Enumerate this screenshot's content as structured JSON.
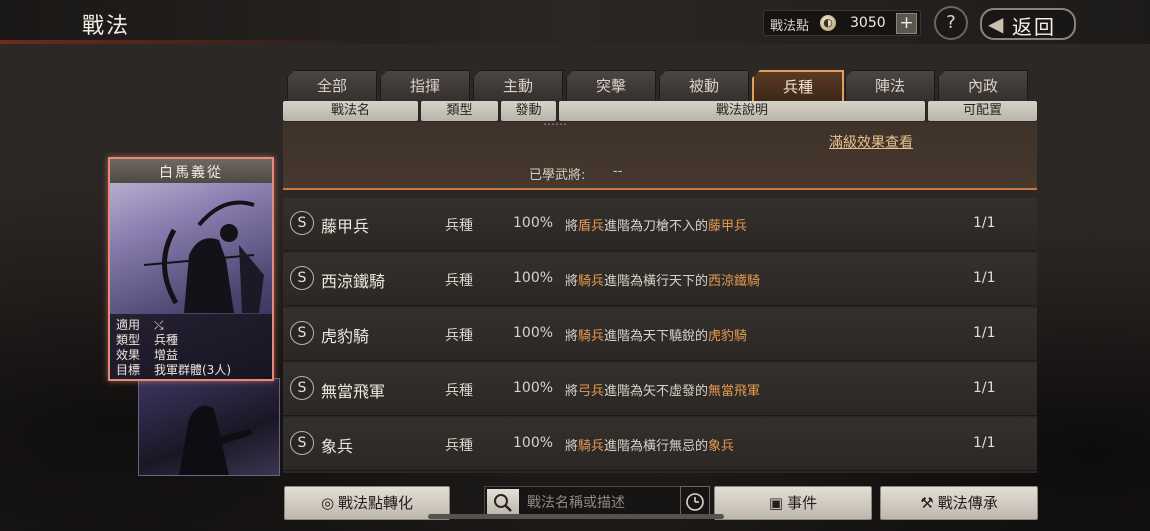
{
  "header": {
    "title": "戰法",
    "points_label": "戰法點",
    "points_value": "3050",
    "plus_label": "+",
    "help_label": "?",
    "back_label": "返回"
  },
  "tabs": [
    {
      "label": "全部",
      "active": false
    },
    {
      "label": "指揮",
      "active": false
    },
    {
      "label": "主動",
      "active": false
    },
    {
      "label": "突擊",
      "active": false
    },
    {
      "label": "被動",
      "active": false
    },
    {
      "label": "兵種",
      "active": true
    },
    {
      "label": "陣法",
      "active": false
    },
    {
      "label": "內政",
      "active": false
    }
  ],
  "columns": [
    "戰法名",
    "類型",
    "發動",
    "戰法說明",
    "可配置"
  ],
  "detail": {
    "full_effect_link": "滿級效果查看",
    "learned_label": "已學武將:",
    "learned_value": "--"
  },
  "skills": [
    {
      "grade": "S",
      "name": "藤甲兵",
      "type": "兵種",
      "rate": "100%",
      "desc_parts": [
        {
          "t": "將",
          "hl": false
        },
        {
          "t": "盾兵",
          "hl": true
        },
        {
          "t": "進階為刀槍不入的",
          "hl": false
        },
        {
          "t": "藤甲兵",
          "hl": true
        }
      ],
      "config": "1/1"
    },
    {
      "grade": "S",
      "name": "西涼鐵騎",
      "type": "兵種",
      "rate": "100%",
      "desc_parts": [
        {
          "t": "將",
          "hl": false
        },
        {
          "t": "騎兵",
          "hl": true
        },
        {
          "t": "進階為橫行天下的",
          "hl": false
        },
        {
          "t": "西涼鐵騎",
          "hl": true
        }
      ],
      "config": "1/1"
    },
    {
      "grade": "S",
      "name": "虎豹騎",
      "type": "兵種",
      "rate": "100%",
      "desc_parts": [
        {
          "t": "將",
          "hl": false
        },
        {
          "t": "騎兵",
          "hl": true
        },
        {
          "t": "進階為天下驍銳的",
          "hl": false
        },
        {
          "t": "虎豹騎",
          "hl": true
        }
      ],
      "config": "1/1"
    },
    {
      "grade": "S",
      "name": "無當飛軍",
      "type": "兵種",
      "rate": "100%",
      "desc_parts": [
        {
          "t": "將",
          "hl": false
        },
        {
          "t": "弓兵",
          "hl": true
        },
        {
          "t": "進階為矢不虛發的",
          "hl": false
        },
        {
          "t": "無當飛軍",
          "hl": true
        }
      ],
      "config": "1/1"
    },
    {
      "grade": "S",
      "name": "象兵",
      "type": "兵種",
      "rate": "100%",
      "desc_parts": [
        {
          "t": "將",
          "hl": false
        },
        {
          "t": "騎兵",
          "hl": true
        },
        {
          "t": "進階為橫行無忌的",
          "hl": false
        },
        {
          "t": "象兵",
          "hl": true
        }
      ],
      "config": "1/1"
    }
  ],
  "card": {
    "title": "白馬義從",
    "info": [
      {
        "label": "適用",
        "value": ""
      },
      {
        "label": "類型",
        "value": "兵種"
      },
      {
        "label": "效果",
        "value": "增益"
      },
      {
        "label": "目標",
        "value": "我軍群體(3人)"
      }
    ]
  },
  "bottom": {
    "convert_label": "戰法點轉化",
    "search_placeholder": "戰法名稱或描述",
    "event_label": "事件",
    "inherit_label": "戰法傳承"
  },
  "colors": {
    "highlight": "#e49a4f",
    "active_tab_border": "#e3a05c",
    "card_border": "#e88a78"
  }
}
